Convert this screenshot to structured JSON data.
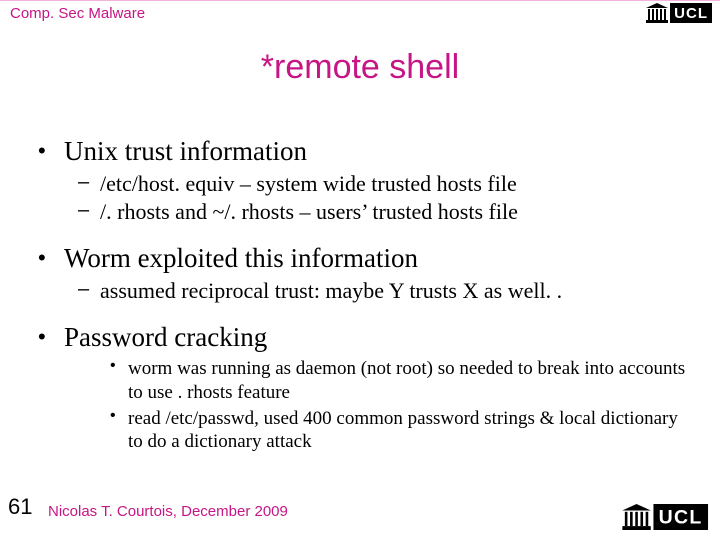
{
  "header": {
    "subject": "Comp. Sec Malware",
    "logo_text": "UCL"
  },
  "title": "*remote shell",
  "b1": {
    "text": "Unix trust information"
  },
  "b1_1": {
    "text": "/etc/host. equiv – system wide trusted hosts file"
  },
  "b1_2": {
    "text": "/. rhosts and ~/. rhosts – users’ trusted hosts file"
  },
  "b2": {
    "text": "Worm exploited this information"
  },
  "b2_1": {
    "text": "assumed reciprocal trust: maybe Y trusts X as well. ."
  },
  "b3": {
    "text": "Password cracking"
  },
  "b3_1": {
    "text": "worm was running as daemon (not root) so needed to break into accounts to use . rhosts feature"
  },
  "b3_2": {
    "text": "read /etc/passwd, used 400 common password strings & local dictionary to do a dictionary attack"
  },
  "footer": {
    "slide_number": "61",
    "author": "Nicolas T. Courtois",
    "sep": ", ",
    "date": "December 2009"
  },
  "bullets": {
    "l1": "•",
    "l2": "–",
    "l3": "•"
  }
}
